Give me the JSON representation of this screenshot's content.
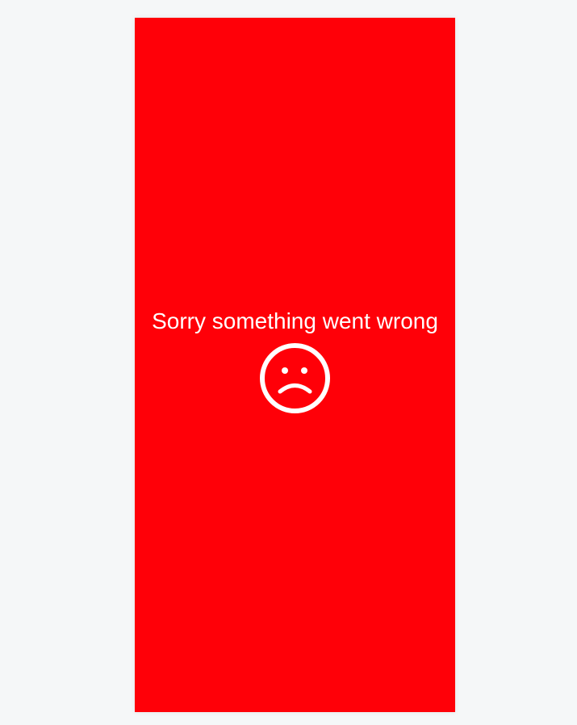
{
  "error": {
    "message": "Sorry something went wrong",
    "icon": "sad-face-icon"
  },
  "colors": {
    "background": "#ff0008",
    "page": "#f5f7f8",
    "foreground": "#ffffff"
  }
}
